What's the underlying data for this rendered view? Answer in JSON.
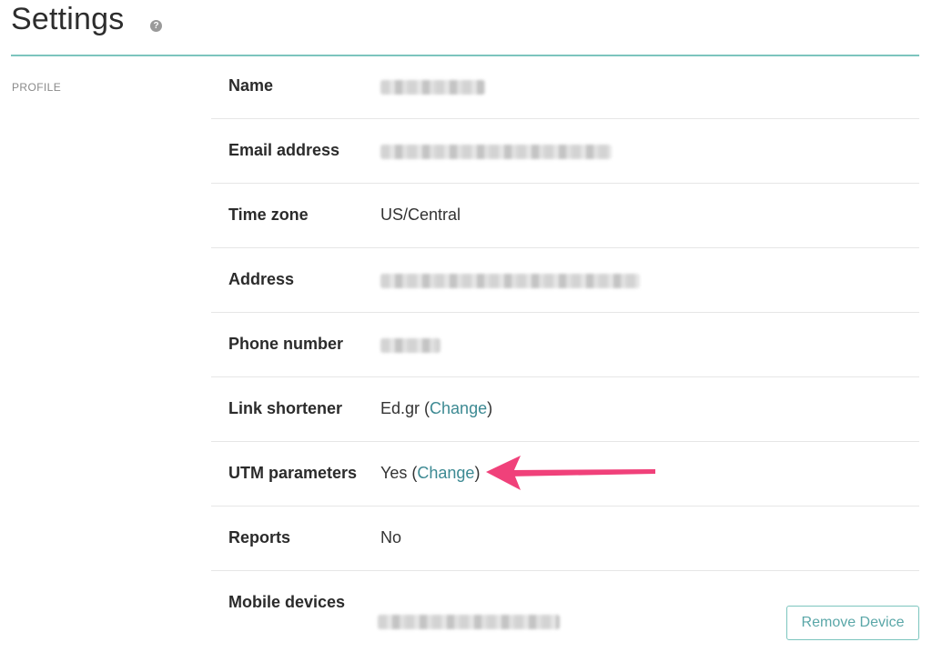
{
  "header": {
    "title": "Settings",
    "help_icon": "?"
  },
  "section": {
    "label": "PROFILE"
  },
  "rows": [
    {
      "label": "Name"
    },
    {
      "label": "Email address"
    },
    {
      "label": "Time zone",
      "value": "US/Central"
    },
    {
      "label": "Address"
    },
    {
      "label": "Phone number"
    },
    {
      "label": "Link shortener",
      "value": "Ed.gr",
      "link": "Change"
    },
    {
      "label": "UTM parameters",
      "value": "Yes",
      "link": "Change"
    },
    {
      "label": "Reports",
      "value": "No"
    },
    {
      "label": "Mobile devices"
    }
  ],
  "buttons": {
    "remove_device": "Remove Device"
  },
  "annotation": {
    "arrow_color": "#f0417a"
  },
  "colors": {
    "accent": "#7cc5be",
    "link": "#3d8a93"
  }
}
